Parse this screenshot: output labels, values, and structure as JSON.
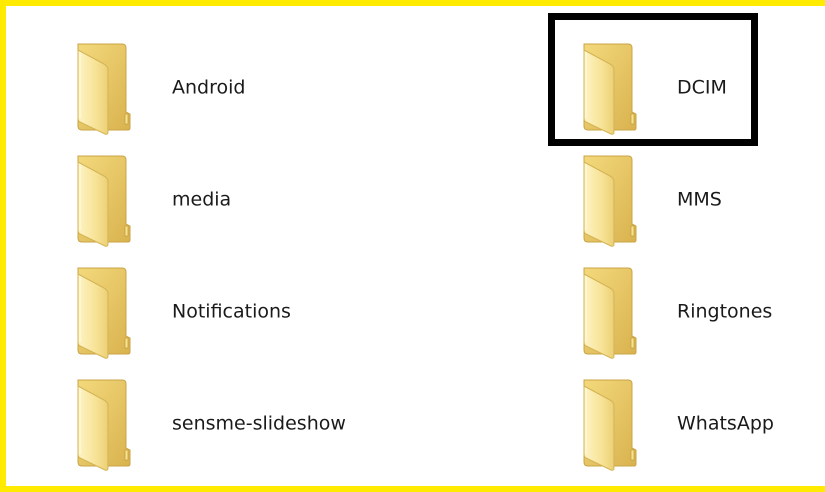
{
  "folders": [
    {
      "name": "Android"
    },
    {
      "name": "DCIM"
    },
    {
      "name": "media"
    },
    {
      "name": "MMS"
    },
    {
      "name": "Notifications"
    },
    {
      "name": "Ringtones"
    },
    {
      "name": "sensme-slideshow"
    },
    {
      "name": "WhatsApp"
    }
  ],
  "icon": "folder-icon",
  "colors": {
    "frame_border": "#ffea00",
    "highlight_border": "#000000",
    "background": "#ffffff",
    "folder_light": "#fbeaa0",
    "folder_dark": "#e2c25e"
  }
}
